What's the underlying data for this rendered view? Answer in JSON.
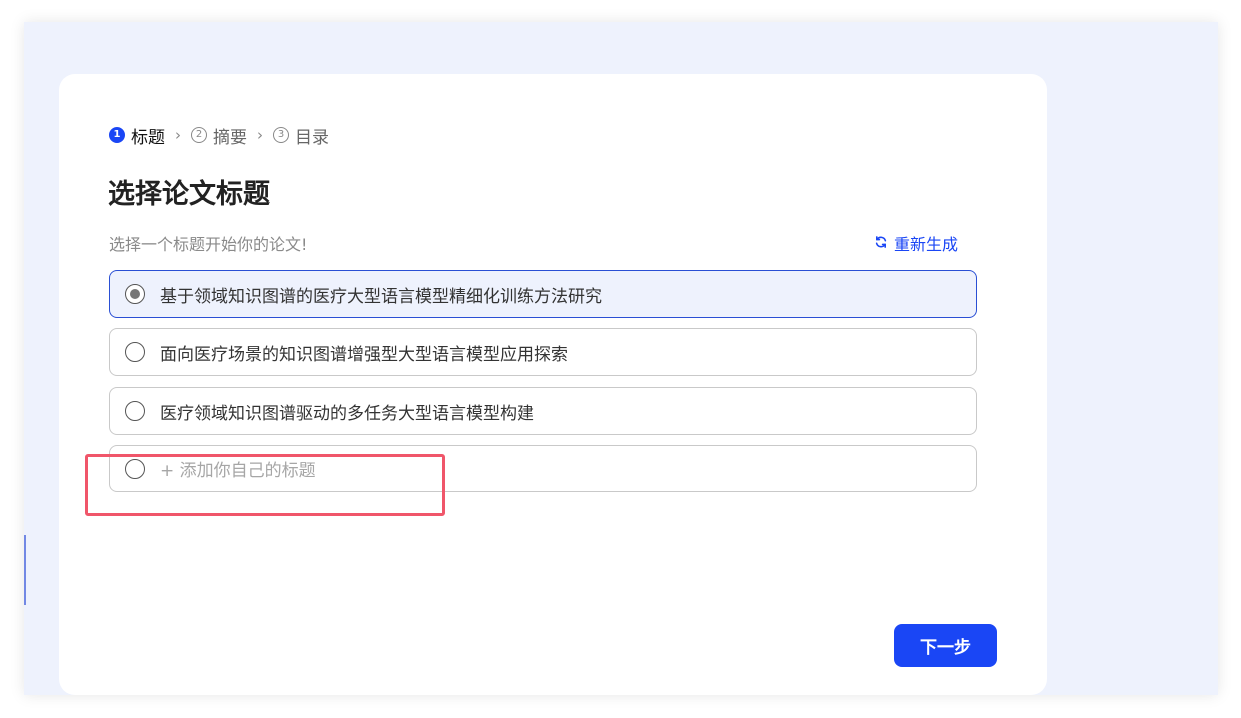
{
  "steps": [
    {
      "num": "1",
      "label": "标题",
      "active": true
    },
    {
      "num": "2",
      "label": "摘要",
      "active": false
    },
    {
      "num": "3",
      "label": "目录",
      "active": false
    }
  ],
  "step_separator": "›",
  "page_title": "选择论文标题",
  "subtitle": "选择一个标题开始你的论文!",
  "regenerate_label": "重新生成",
  "options": [
    {
      "label": "基于领域知识图谱的医疗大型语言模型精细化训练方法研究",
      "selected": true
    },
    {
      "label": "面向医疗场景的知识图谱增强型大型语言模型应用探索",
      "selected": false
    },
    {
      "label": "医疗领域知识图谱驱动的多任务大型语言模型构建",
      "selected": false
    }
  ],
  "add_option_label": "+ 添加你自己的标题",
  "next_button_label": "下一步",
  "colors": {
    "accent": "#1a46f5",
    "background": "#eef2fd",
    "highlight": "#f0566a"
  }
}
